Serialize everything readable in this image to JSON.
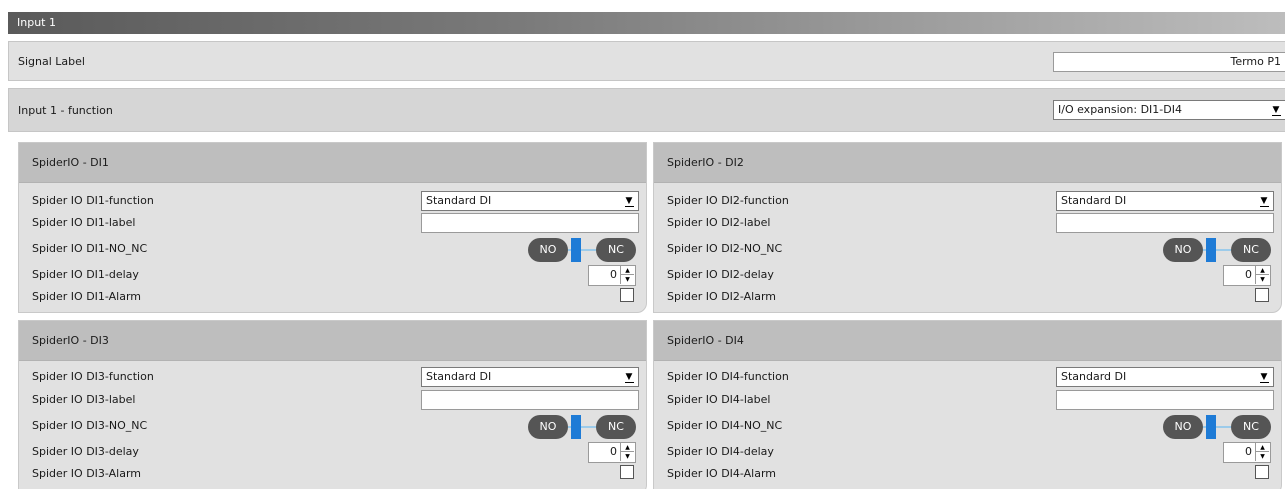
{
  "window": {
    "title": "Input 1"
  },
  "signal": {
    "label": "Signal Label",
    "value": "Termo P1"
  },
  "function_row": {
    "label": "Input 1 - function",
    "selected": "I/O expansion: DI1-DI4"
  },
  "panels": [
    {
      "title": "SpiderIO - DI1",
      "function_label": "Spider IO DI1-function",
      "function_value": "Standard DI",
      "label_label": "Spider IO DI1-label",
      "label_value": "",
      "nonc_label": "Spider IO DI1-NO_NC",
      "no": "NO",
      "nc": "NC",
      "delay_label": "Spider IO DI1-delay",
      "delay_value": "0",
      "alarm_label": "Spider IO DI1-Alarm"
    },
    {
      "title": "SpiderIO - DI2",
      "function_label": "Spider IO DI2-function",
      "function_value": "Standard DI",
      "label_label": "Spider IO DI2-label",
      "label_value": "",
      "nonc_label": "Spider IO DI2-NO_NC",
      "no": "NO",
      "nc": "NC",
      "delay_label": "Spider IO DI2-delay",
      "delay_value": "0",
      "alarm_label": "Spider IO DI2-Alarm"
    },
    {
      "title": "SpiderIO - DI3",
      "function_label": "Spider IO DI3-function",
      "function_value": "Standard DI",
      "label_label": "Spider IO DI3-label",
      "label_value": "",
      "nonc_label": "Spider IO DI3-NO_NC",
      "no": "NO",
      "nc": "NC",
      "delay_label": "Spider IO DI3-delay",
      "delay_value": "0",
      "alarm_label": "Spider IO DI3-Alarm"
    },
    {
      "title": "SpiderIO - DI4",
      "function_label": "Spider IO DI4-function",
      "function_value": "Standard DI",
      "label_label": "Spider IO DI4-label",
      "label_value": "",
      "nonc_label": "Spider IO DI4-NO_NC",
      "no": "NO",
      "nc": "NC",
      "delay_label": "Spider IO DI4-delay",
      "delay_value": "0",
      "alarm_label": "Spider IO DI4-Alarm"
    }
  ],
  "icons": {
    "dropdown": "chevron-down-icon",
    "spin_up": "spin-up-icon",
    "spin_down": "spin-down-icon",
    "checkbox": "checkbox-unchecked"
  },
  "colors": {
    "toggle_pill": "#555555",
    "toggle_knob": "#1e7bd6",
    "panel_header": "#bebebe",
    "panel_body": "#e1e1e1"
  }
}
